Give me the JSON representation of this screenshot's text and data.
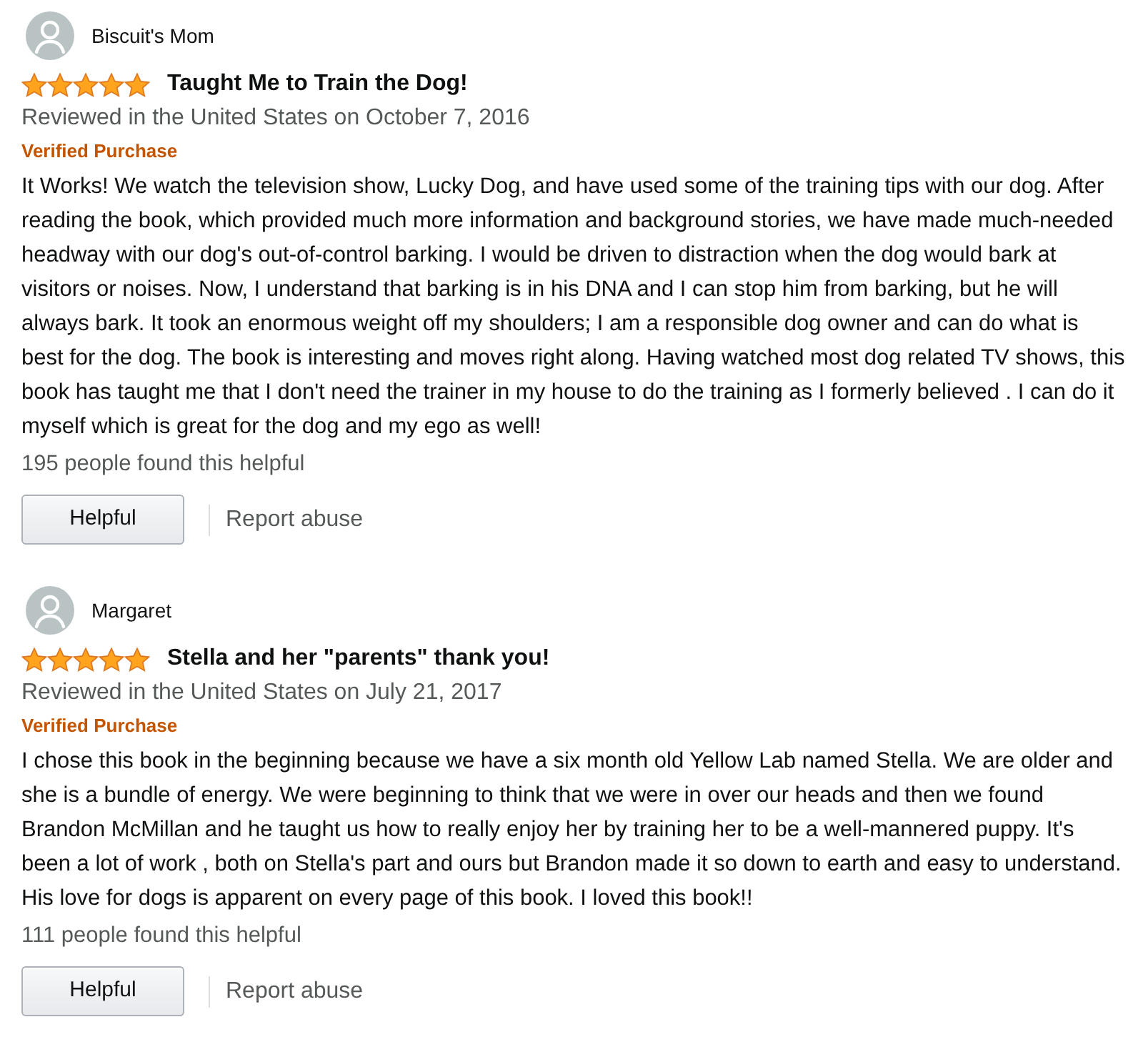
{
  "reviews": [
    {
      "reviewer": {
        "name": "Biscuit's Mom"
      },
      "stars": 5,
      "title": "Taught Me to Train the Dog!",
      "date": "Reviewed in the United States on October 7, 2016",
      "badge": "Verified Purchase",
      "body": "It Works! We watch the television show, Lucky Dog, and have used some of the training tips with our dog. After reading the book, which provided much more information and background stories, we have made much-needed headway with our dog's out-of-control barking. I would be driven to distraction when the dog would bark at visitors or noises. Now, I understand that barking is in his DNA and I can stop him from barking, but he will always bark. It took an enormous weight off my shoulders; I am a responsible dog owner and can do what is best for the dog. The book is interesting and moves right along. Having watched most dog related TV shows, this book has taught me that I don't need the trainer in my house to do the training as I formerly believed . I can do it myself which is great for the dog and my ego as well!",
      "helpful_count": "195 people found this helpful",
      "helpful_button": "Helpful",
      "report_link": "Report abuse"
    },
    {
      "reviewer": {
        "name": "Margaret"
      },
      "stars": 5,
      "title": "Stella and her \"parents\" thank you!",
      "date": "Reviewed in the United States on July 21, 2017",
      "badge": "Verified Purchase",
      "body": "I chose this book in the beginning because we have a six month old Yellow Lab named Stella. We are older and she is a bundle of energy. We were beginning to think that we were in over our heads and then we found Brandon McMillan and he taught us how to really enjoy her by training her to be a well-mannered puppy. It's been a lot of work , both on Stella's part and ours but Brandon made it so down to earth and easy to understand. His love for dogs is apparent on every page of this book. I loved this book!!",
      "helpful_count": "111 people found this helpful",
      "helpful_button": "Helpful",
      "report_link": "Report abuse"
    }
  ]
}
